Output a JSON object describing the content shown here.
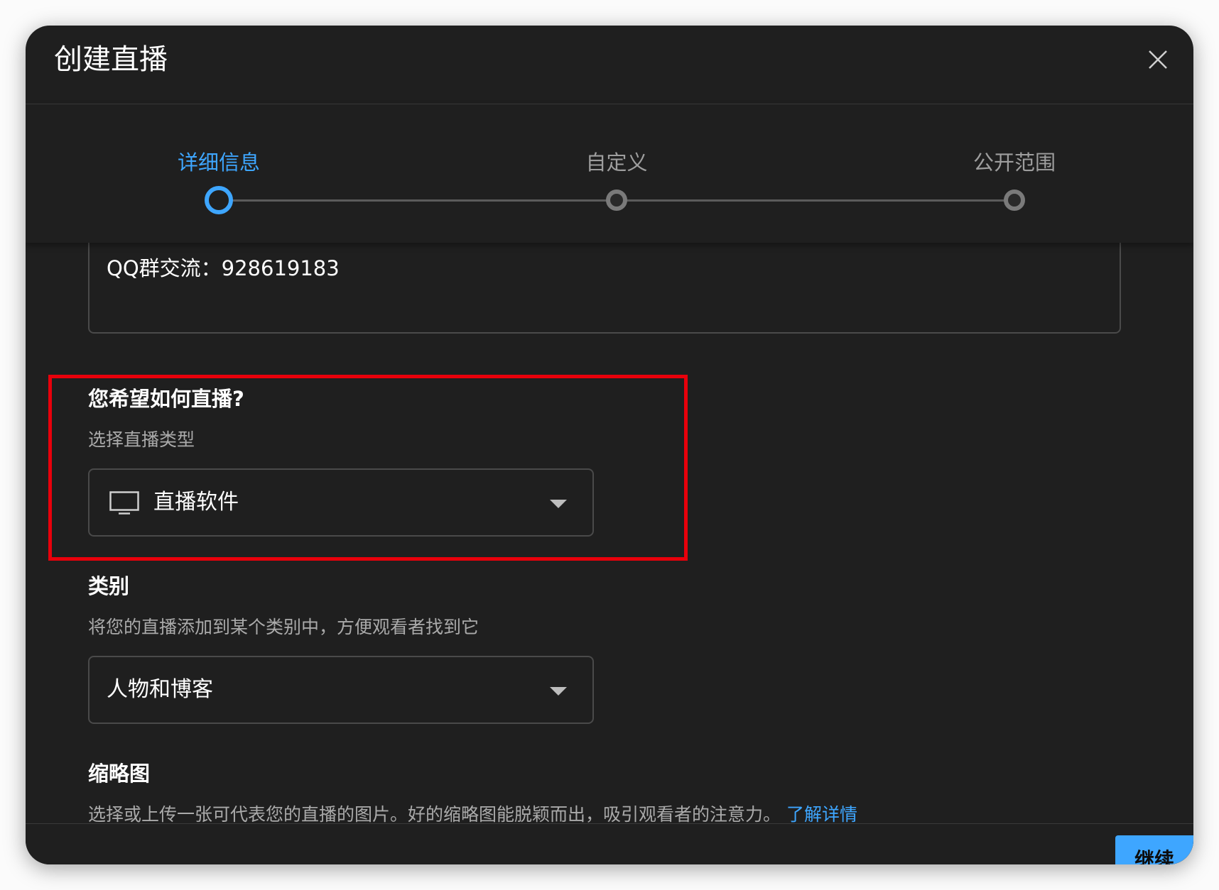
{
  "dialog": {
    "title": "创建直播",
    "close_icon": "close-icon"
  },
  "stepper": {
    "steps": [
      {
        "label": "详细信息",
        "state": "active"
      },
      {
        "label": "自定义",
        "state": "inactive"
      },
      {
        "label": "公开范围",
        "state": "inactive"
      }
    ]
  },
  "description": {
    "text": "QQ群交流：928619183"
  },
  "stream_type": {
    "title": "您希望如何直播?",
    "subtitle": "选择直播类型",
    "selected": "直播软件",
    "icon": "monitor-icon"
  },
  "category": {
    "title": "类别",
    "subtitle": "将您的直播添加到某个类别中，方便观看者找到它",
    "selected": "人物和博客"
  },
  "thumbnail": {
    "title": "缩略图",
    "subtitle": "选择或上传一张可代表您的直播的图片。好的缩略图能脱颖而出，吸引观看者的注意力。",
    "link": "了解详情"
  },
  "footer": {
    "continue_label": "继续"
  },
  "colors": {
    "accent": "#3ea6ff",
    "background": "#1f1f1f",
    "highlight": "#e8000b"
  }
}
